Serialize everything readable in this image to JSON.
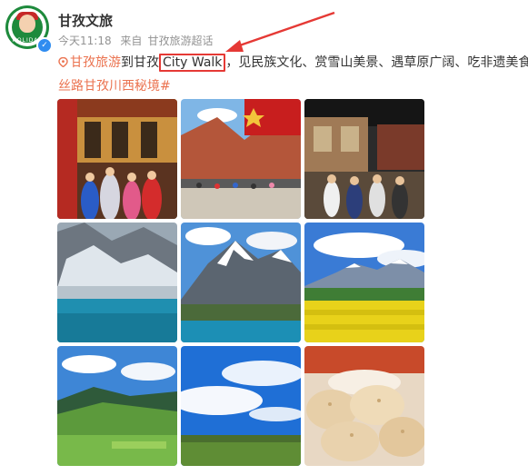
{
  "post": {
    "author": "甘孜文旅",
    "avatar_text": "HOLIDAY",
    "verified_mark": "✓",
    "time": "今天11:18",
    "source_label": "来自",
    "source": "甘孜旅游超话",
    "text": {
      "topic_link": "甘孜旅游",
      "part1": "到甘孜",
      "highlight": "City Walk",
      "part2": "，见民族文化、赏雪山美景、遇草原广阔、吃非遗美食！"
    },
    "hashtag": "丝路甘孜川西秘境#",
    "images": [
      {
        "desc": "ethnic-performance-photo"
      },
      {
        "desc": "mountain-mural-monument-photo"
      },
      {
        "desc": "museum-visitors-photo"
      },
      {
        "desc": "glacier-lake-photo"
      },
      {
        "desc": "snow-peak-lake-photo"
      },
      {
        "desc": "rapeseed-field-mountain-photo"
      },
      {
        "desc": "green-valley-photo"
      },
      {
        "desc": "blue-sky-grassland-photo"
      },
      {
        "desc": "pastry-food-photo"
      }
    ]
  },
  "colors": {
    "link": "#eb7350",
    "highlight_box": "#e53935",
    "meta": "#939393",
    "verify": "#2f8cf0",
    "avatar_green": "#1e8a3c"
  },
  "icons": [
    "location-pin-icon",
    "verified-icon",
    "annotation-arrow-icon"
  ]
}
